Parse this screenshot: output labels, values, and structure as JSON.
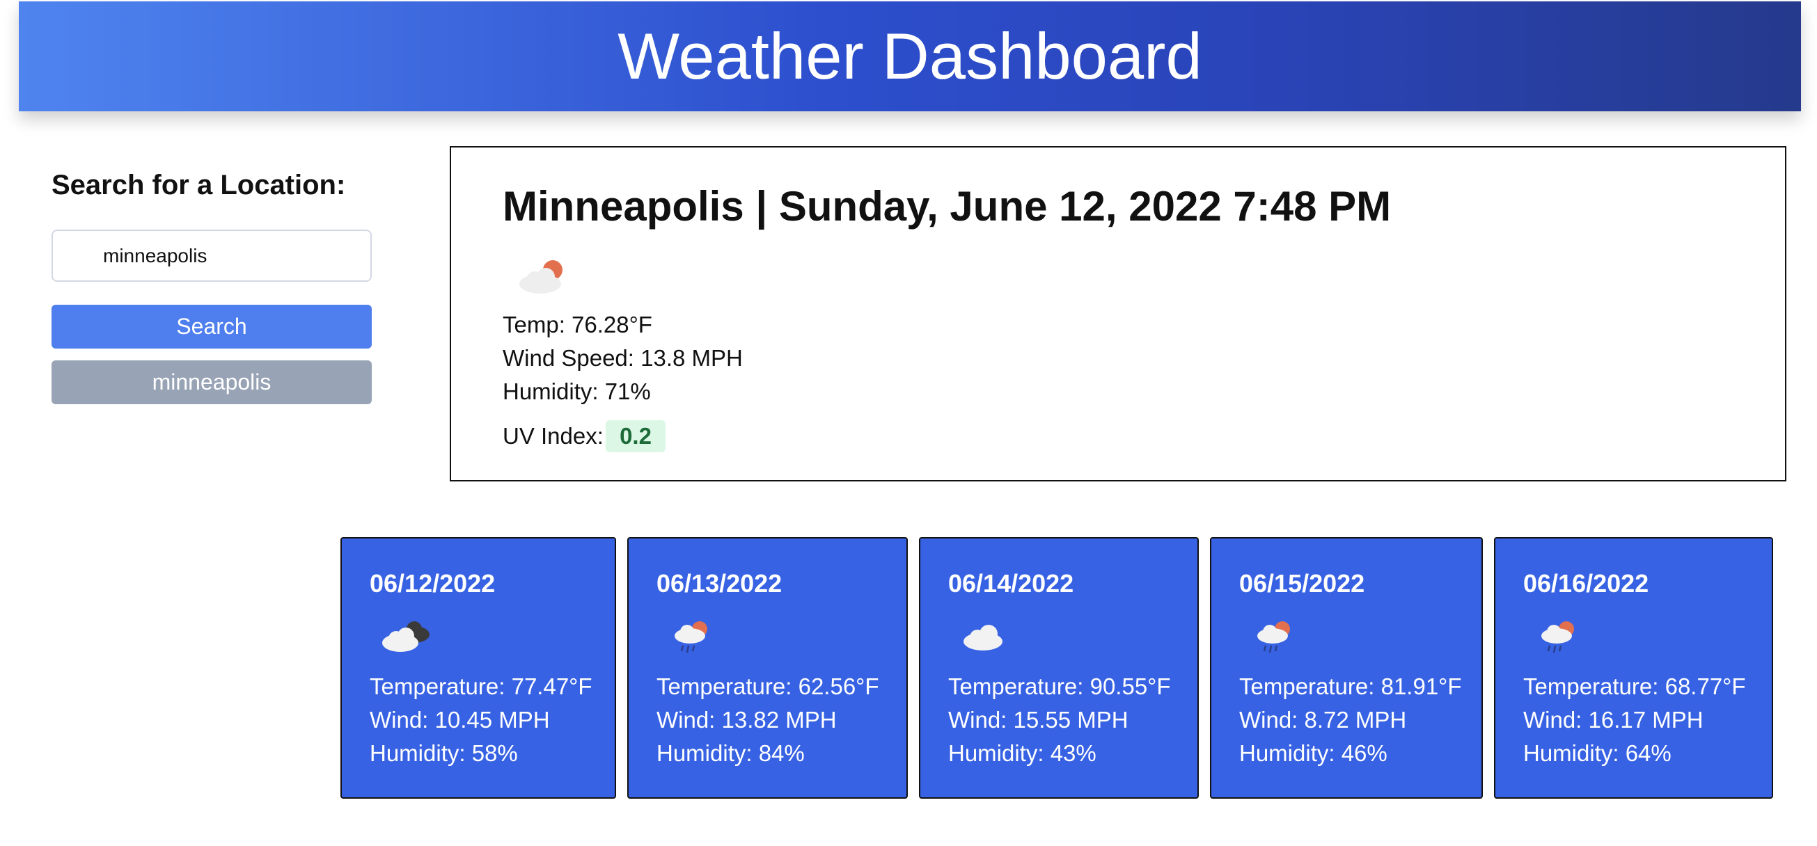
{
  "header": {
    "title": "Weather Dashboard"
  },
  "sidebar": {
    "title": "Search for a Location:",
    "search_value": "minneapolis",
    "search_button": "Search",
    "history": [
      "minneapolis"
    ]
  },
  "current": {
    "title": "Minneapolis | Sunday, June 12, 2022 7:48 PM",
    "icon": "few-clouds-icon",
    "temp": "Temp: 76.28°F",
    "wind": "Wind Speed: 13.8 MPH",
    "humidity": "Humidity: 71%",
    "uv_label": "UV Index:",
    "uv_value": "0.2",
    "uv_color": "#dcf7e5"
  },
  "forecast": [
    {
      "date": "06/12/2022",
      "icon": "broken-clouds-icon",
      "temp": "Temperature: 77.47°F",
      "wind": "Wind: 10.45 MPH",
      "humidity": "Humidity: 58%"
    },
    {
      "date": "06/13/2022",
      "icon": "rain-sun-icon",
      "temp": "Temperature: 62.56°F",
      "wind": "Wind: 13.82 MPH",
      "humidity": "Humidity: 84%"
    },
    {
      "date": "06/14/2022",
      "icon": "cloud-icon",
      "temp": "Temperature: 90.55°F",
      "wind": "Wind: 15.55 MPH",
      "humidity": "Humidity: 43%"
    },
    {
      "date": "06/15/2022",
      "icon": "rain-sun-icon",
      "temp": "Temperature: 81.91°F",
      "wind": "Wind: 8.72 MPH",
      "humidity": "Humidity: 46%"
    },
    {
      "date": "06/16/2022",
      "icon": "rain-sun-icon",
      "temp": "Temperature: 68.77°F",
      "wind": "Wind: 16.17 MPH",
      "humidity": "Humidity: 64%"
    }
  ],
  "colors": {
    "header_gradient_start": "#4f84ef",
    "header_gradient_end": "#253a8c",
    "search_button": "#4f7fee",
    "history_button": "#98a3b5",
    "card_background": "#3762e3"
  }
}
